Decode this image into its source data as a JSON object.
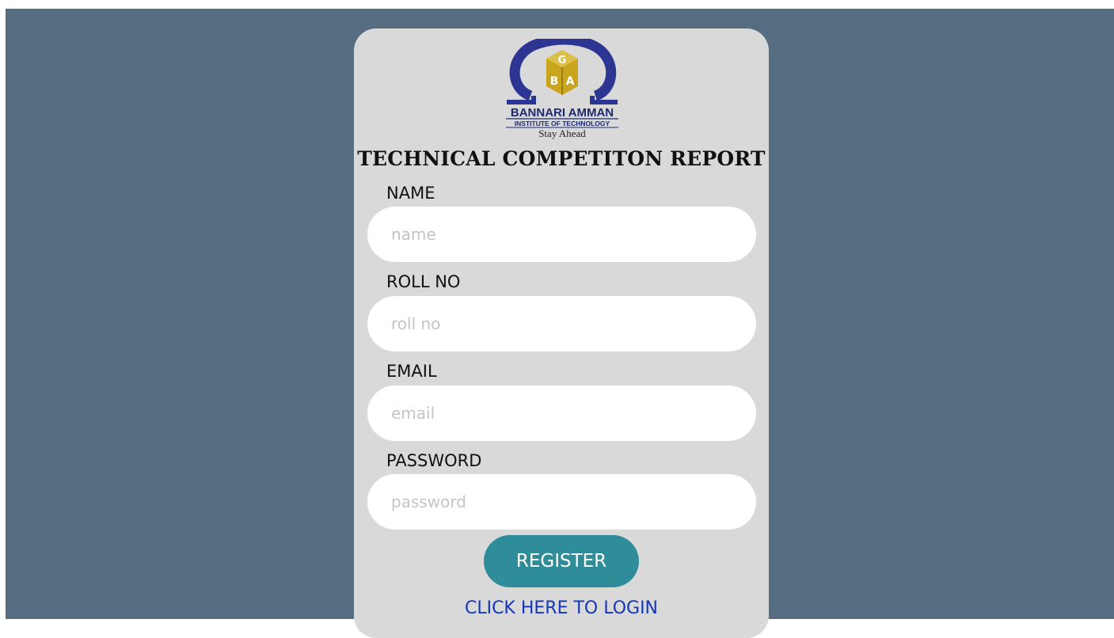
{
  "logo": {
    "letters": [
      "G",
      "B",
      "A"
    ],
    "institute_name": "BANNARI AMMAN",
    "institute_subtitle": "INSTITUTE OF TECHNOLOGY",
    "tagline": "Stay Ahead",
    "colors": {
      "omega": "#2c3592",
      "emblem": "#c9a51e"
    }
  },
  "form": {
    "title": "TECHNICAL COMPETITON REPORT",
    "fields": [
      {
        "label": "NAME",
        "placeholder": "name",
        "value": ""
      },
      {
        "label": "ROLL NO",
        "placeholder": "roll no",
        "value": ""
      },
      {
        "label": "EMAIL",
        "placeholder": "email",
        "value": ""
      },
      {
        "label": "PASSWORD",
        "placeholder": "password",
        "value": ""
      }
    ],
    "register_label": "REGISTER",
    "login_link": "CLICK HERE TO LOGIN"
  },
  "colors": {
    "background": "#566c81",
    "card": "#d9d9d9",
    "button": "#2e8d99",
    "link": "#1636b8"
  }
}
